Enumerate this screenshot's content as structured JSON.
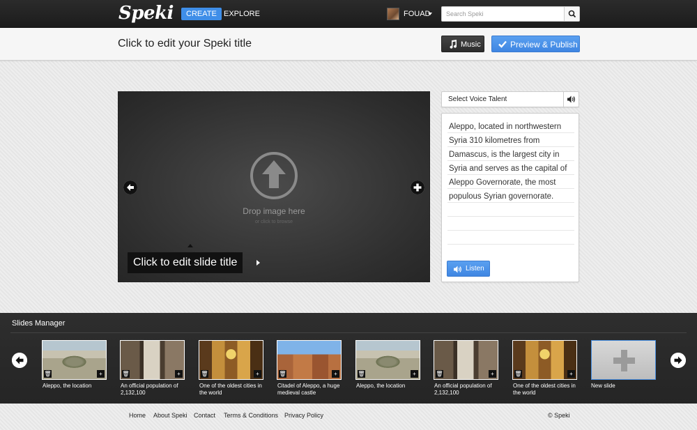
{
  "app": {
    "logo": "Speki",
    "nav": {
      "create": "CREATE",
      "explore": "EXPLORE"
    },
    "user": {
      "name": "FOUAD"
    },
    "search": {
      "placeholder": "Search Speki"
    }
  },
  "toolbar": {
    "title": "Click to edit your Speki title",
    "music_label": "Music",
    "publish_label": "Preview & Publish"
  },
  "editor": {
    "drop_text": "Drop image here",
    "browse_text": "or click to browse",
    "slide_title": "Click to edit slide title"
  },
  "voice": {
    "select_label": "Select Voice Talent",
    "script": "Aleppo, located in northwestern Syria 310 kilometres from Damascus, is the largest city in Syria and serves as the capital of Aleppo Governorate, the most populous Syrian governorate.",
    "listen_label": "Listen"
  },
  "slides_manager": {
    "title": "Slides Manager",
    "slides": [
      {
        "caption": "Aleppo, the location"
      },
      {
        "caption": "An official population of 2,132,100"
      },
      {
        "caption": "One of the oldest cities in the world"
      },
      {
        "caption": "Citadel of Aleppo, a huge medieval castle"
      },
      {
        "caption": "Aleppo, the location"
      },
      {
        "caption": "An official population of 2,132,100"
      },
      {
        "caption": "One of the oldest cities in the world"
      }
    ],
    "new_slide_label": "New slide"
  },
  "footer": {
    "links": [
      "Home",
      "About Speki",
      "Contact",
      "Terms & Conditions",
      "Privacy Policy"
    ],
    "copyright": "© Speki"
  },
  "colors": {
    "accent": "#3f8ee8",
    "dark_bar": "#2b2b2b"
  }
}
